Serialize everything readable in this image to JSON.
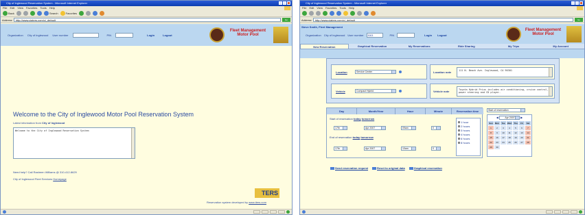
{
  "left": {
    "title": "City of Inglewood Reservation System - Microsoft Internet Explorer",
    "menu": [
      "File",
      "Edit",
      "View",
      "Favorites",
      "Tools",
      "Help"
    ],
    "toolbar": {
      "back": "Back",
      "search": "Search",
      "favorites": "Favorites"
    },
    "address_label": "Address",
    "address": "http://www.ciaters.com/ci_default",
    "go": "Go",
    "header": {
      "org_label": "Organization",
      "org_value": "City of Inglewood",
      "user_label": "User number",
      "pin_label": "PIN",
      "login": "Login",
      "logout": "Logout",
      "brand_line1": "Fleet Management",
      "brand_line2": "Motor Pool"
    },
    "welcome": "Welcome to the City of Inglewood Motor Pool Reservation System",
    "latest_prefix": "Latest information from ",
    "latest_org": "City of Inglewood",
    "textarea": "Welcome to the City of Inglewood Reservation System",
    "help": "Need help? Call Rasheen Williams @ 310-412-8629",
    "fleet_prefix": "City of Inglewood Fleet Services ",
    "homepage": "Homepage",
    "brand": "TERS",
    "developed_prefix": "Reservation system developed by ",
    "developed_link": "www.iters.com"
  },
  "right": {
    "title": "City of Inglewood Reservation System - Microsoft Internet Explorer",
    "menu": [
      "File",
      "Edit",
      "View",
      "Favorites",
      "Tools",
      "Help"
    ],
    "address_label": "Address",
    "address": "http://www.ciaters.com/ci_default",
    "go": "Go",
    "header": {
      "user_name": "Steve Smith, Fleet Management",
      "org_label": "Organization",
      "org_value": "City of Inglewood",
      "user_label": "User number",
      "user_value": "3003",
      "pin_label": "PIN",
      "login": "Login",
      "logout": "Logout",
      "brand_line1": "Fleet Management",
      "brand_line2": "Motor Pool"
    },
    "tabs": [
      "New Reservation",
      "Graphical Reservation",
      "My Reservations",
      "Ride Sharing",
      "My Trips",
      "My Account"
    ],
    "location_label": "Location",
    "location_value": "Service Center",
    "location_note_label": "Location note",
    "location_note": "111 N. Beach Ave. Inglewood, CA 90301",
    "vehicle_label": "Vehicle",
    "vehicle_value": "Compact Hybrid",
    "vehicle_note_label": "Vehicle note",
    "vehicle_note": "Toyota Hybrid Prius includes air conditioning, cruise control, power steering and CD player.",
    "table_headers": [
      "Day",
      "Month/Year",
      "Hour",
      "Minute",
      "Reservation time"
    ],
    "start_label": "Start of reservation",
    "end_label": "End of reservation",
    "today": "today",
    "tomorrow": "tomorrow",
    "start_day": "17th",
    "start_month": "Apr 2007",
    "start_hour": "09am",
    "start_minute": "0",
    "end_day": "17th",
    "end_month": "Apr 2007",
    "end_hour": "10am",
    "end_minute": "0",
    "durations": [
      "1 hour",
      "2 hours",
      "3 hours",
      "4 hours",
      "6 hours",
      "8 hours"
    ],
    "cal_select": "Start of reservation",
    "cal_month": "Apr 2007",
    "cal_days": [
      "Sun",
      "Mon",
      "Tue",
      "Wed",
      "Thu",
      "Fri",
      "Sat"
    ],
    "footer_submit": "Send reservation request",
    "footer_reset": "Reset to original data",
    "footer_graph": "Graphical reservation"
  }
}
